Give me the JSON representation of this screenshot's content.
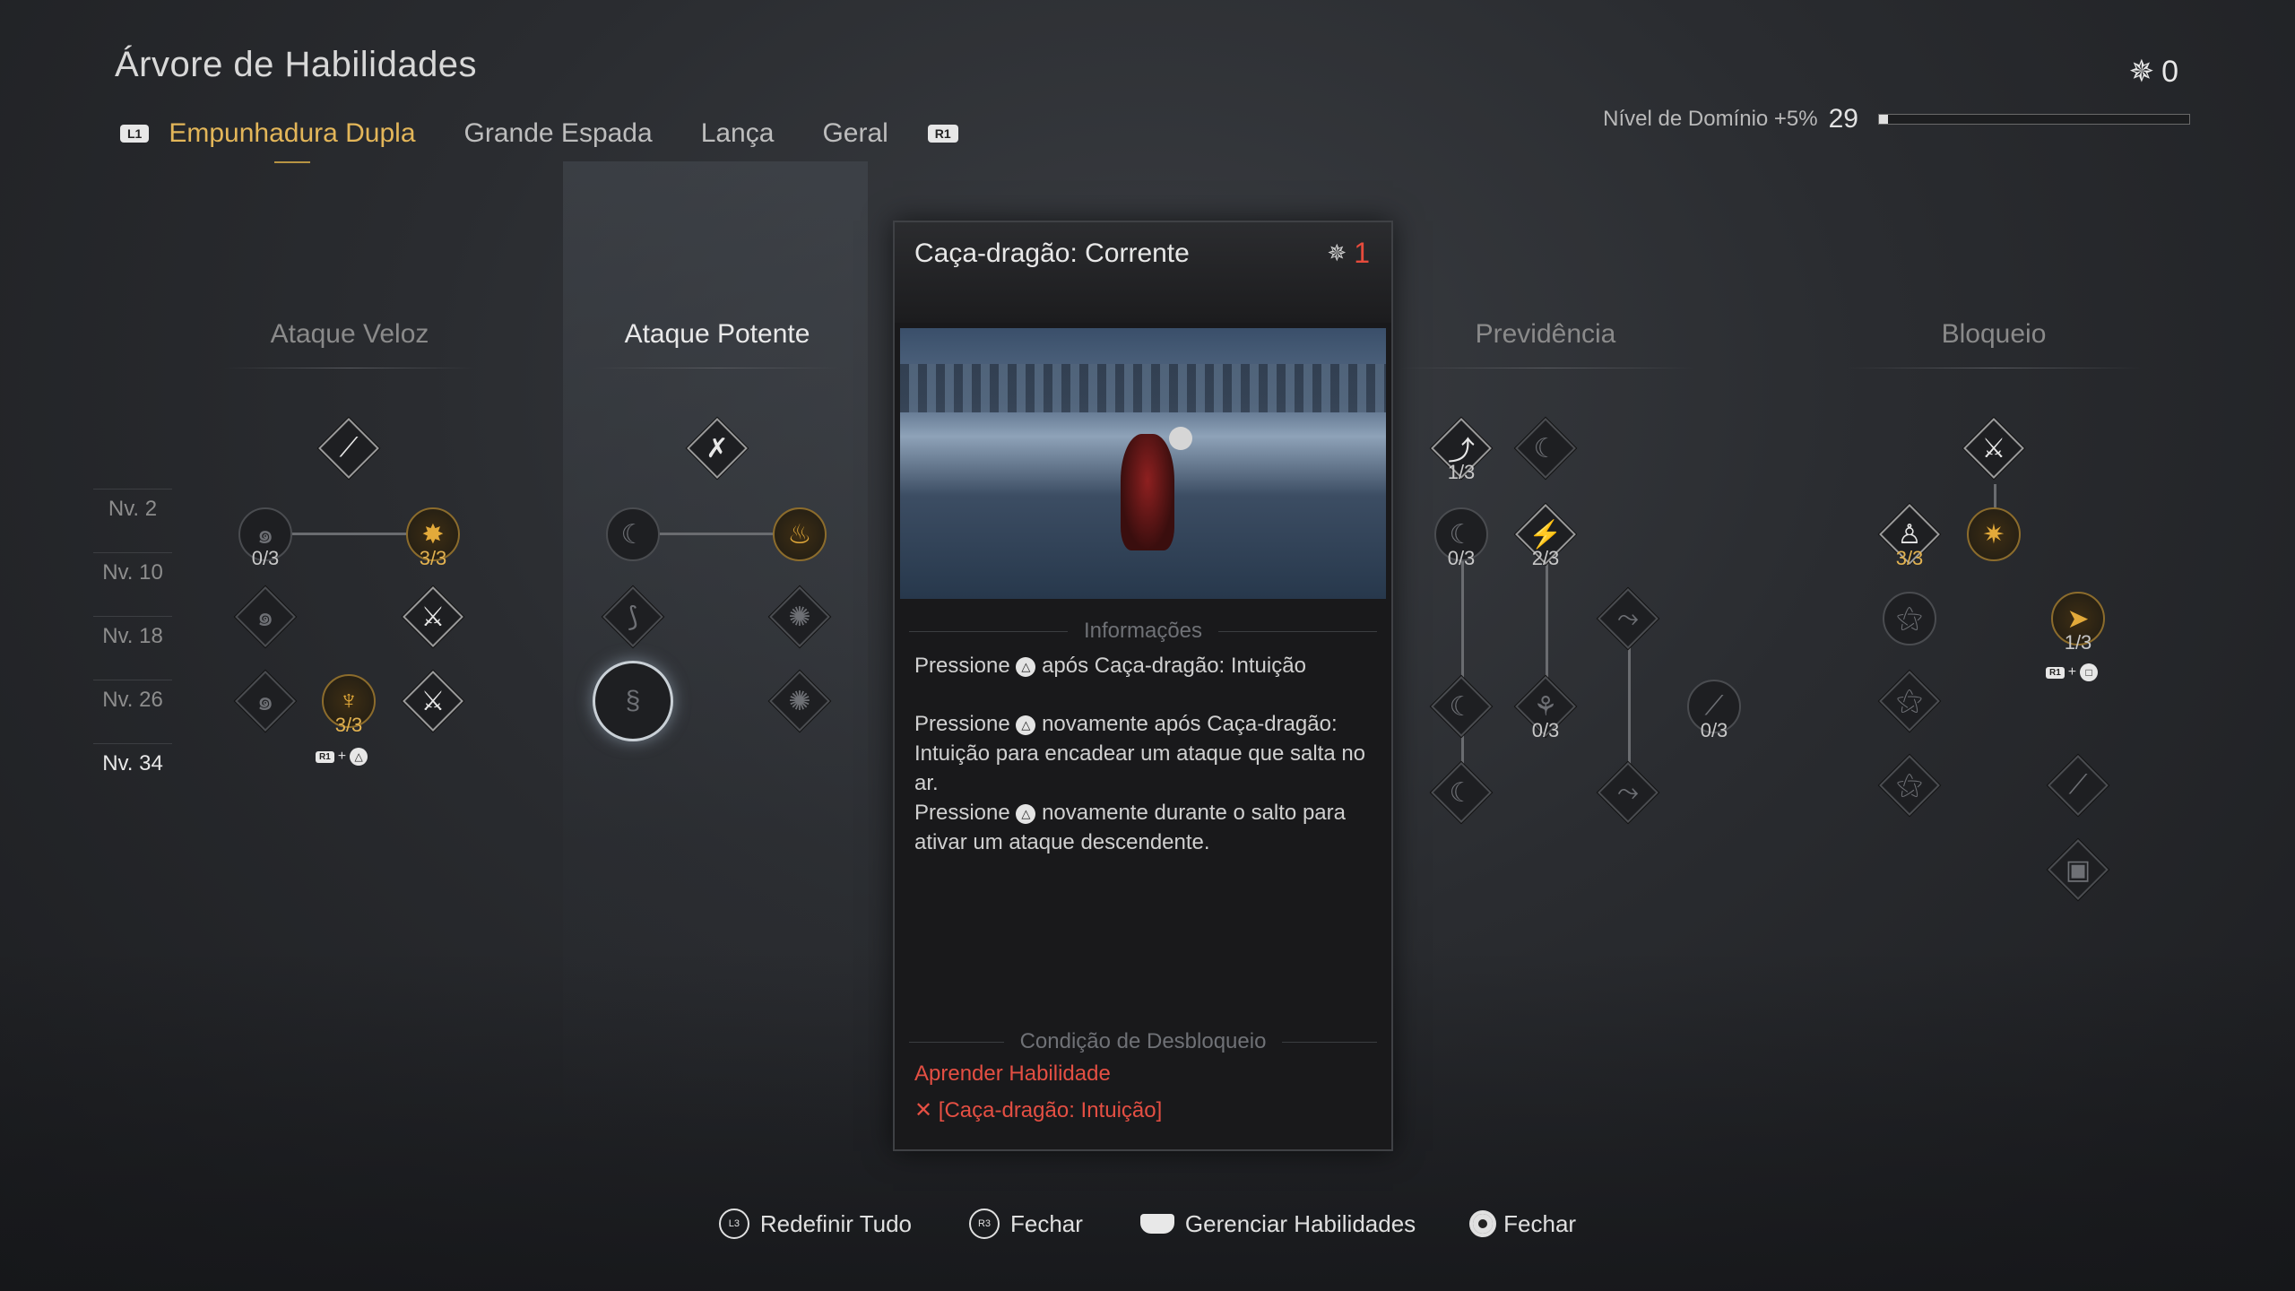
{
  "header": {
    "title": "Árvore de Habilidades",
    "points": "0",
    "mastery_label": "Nível de Domínio +5%",
    "mastery_level": "29",
    "mastery_progress": 0.03
  },
  "tabs": {
    "left_button": "L1",
    "right_button": "R1",
    "items": [
      "Empunhadura Dupla",
      "Grande Espada",
      "Lança",
      "Geral"
    ],
    "active": 0
  },
  "levels": [
    "Nv. 2",
    "Nv. 10",
    "Nv. 18",
    "Nv. 26",
    "Nv. 34"
  ],
  "columns": [
    "Ataque Veloz",
    "Ataque Potente",
    "Previdência",
    "Bloqueio"
  ],
  "counters": {
    "av_1": "0/3",
    "av_2": "3/3",
    "av_3": "3/3",
    "pr_1": "1/3",
    "pr_2": "0/3",
    "pr_3": "2/3",
    "pr_4": "0/3",
    "pr_5": "0/3",
    "bl_1": "3/3",
    "bl_2": "1/3"
  },
  "combo": {
    "r1": "R1",
    "plus": "+",
    "triangle": "△",
    "square": "□"
  },
  "card": {
    "name": "Caça-dragão: Corrente",
    "cost": "1",
    "info_heading": "Informações",
    "p1_a": "Pressione",
    "p1_b": "após Caça-dragão: Intuição",
    "p2_a": "Pressione",
    "p2_b": "novamente após Caça-dragão: Intuição para encadear um ataque que salta no ar.",
    "p3_a": "Pressione",
    "p3_b": "novamente durante o salto para ativar um ataque descendente.",
    "unlock_heading": "Condição de Desbloqueio",
    "unlock_1": "Aprender Habilidade",
    "unlock_2": "✕ [Caça-dragão: Intuição]"
  },
  "footer": [
    {
      "icon": "L3",
      "label": "Redefinir Tudo"
    },
    {
      "icon": "R3",
      "label": "Fechar"
    },
    {
      "icon": "touchpad",
      "label": "Gerenciar Habilidades"
    },
    {
      "icon": "circle",
      "label": "Fechar"
    }
  ]
}
